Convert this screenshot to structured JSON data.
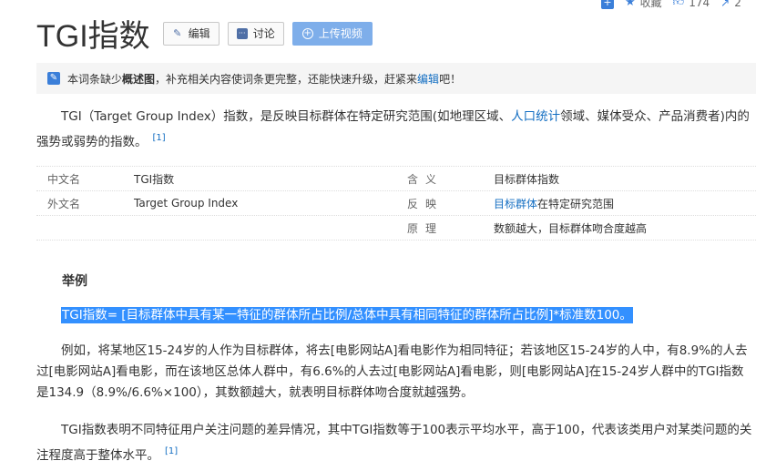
{
  "top_actions": {
    "add_icon": "plus-square-icon",
    "collect_label": "收藏",
    "like_count": "174",
    "share_count": "2"
  },
  "title": "TGI指数",
  "buttons": {
    "edit": "编辑",
    "discuss": "讨论",
    "upload_video": "上传视频"
  },
  "notice": {
    "prefix": "本词条缺少",
    "bold": "概述图",
    "middle": "，补充相关内容使词条更完整，还能快速升级，赶紧来",
    "link": "编辑",
    "suffix": "吧！"
  },
  "intro": {
    "text_before": "TGI（Target Group Index）指数，是反映目标群体在特定研究范围(如地理区域、",
    "link": "人口统计",
    "text_after": "领域、媒体受众、产品消费者)内的强势或弱势的指数。",
    "ref": "[1]"
  },
  "info_table": {
    "rows": [
      {
        "k1": "中文名",
        "v1": "TGI指数",
        "k2": "含义",
        "v2": "目标群体指数"
      },
      {
        "k1": "外文名",
        "v1": "Target Group Index",
        "k2": "反映",
        "v2_link": "目标群体",
        "v2": "在特定研究范围"
      },
      {
        "k1": "",
        "v1": "",
        "k2": "原理",
        "v2": "数额越大，目标群体吻合度越高"
      }
    ]
  },
  "section_heading": "举例",
  "formula": "TGI指数= [目标群体中具有某一特征的群体所占比例/总体中具有相同特征的群体所占比例]*标准数100。",
  "example_paragraph": "例如，将某地区15-24岁的人作为目标群体，将去[电影网站A]看电影作为相同特征；若该地区15-24岁的人中，有8.9%的人去过[电影网站A]看电影，而在该地区总体人群中，有6.6%的人去过[电影网站A]看电影，则[电影网站A]在15-24岁人群中的TGI指数是134.9（8.9%/6.6%×100），其数额越大，就表明目标群体吻合度就越强势。",
  "closing_paragraph": {
    "text": "TGI指数表明不同特征用户关注问题的差异情况，其中TGI指数等于100表示平均水平，高于100，代表该类用户对某类问题的关注程度高于整体水平。",
    "ref": "[1]"
  }
}
